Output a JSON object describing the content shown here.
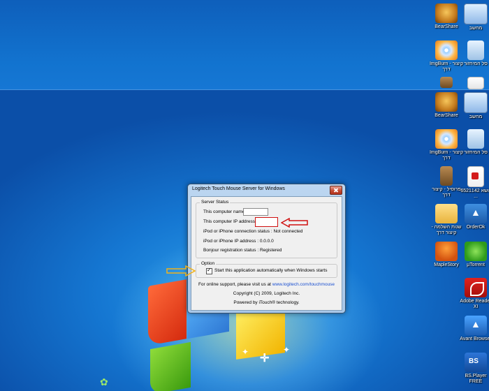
{
  "dialog": {
    "title": "Logitech Touch Mouse Server for Windows",
    "server_status": {
      "legend": "Server Status",
      "computer_name_label": "This computer name :",
      "computer_name_value": "",
      "ip_label": "This computer IP address :",
      "ip_value": "",
      "connection_label": "iPod or iPhone connection status :",
      "connection_value": "Not connected",
      "device_ip_label": "iPod or iPhone IP address :",
      "device_ip_value": "0.0.0.0",
      "bonjour_label": "Bonjour registration status :",
      "bonjour_value": "Registered"
    },
    "option": {
      "legend": "Option",
      "autostart_label": "Start this application automatically when Windows starts",
      "autostart_checked": true
    },
    "support_prefix": "For online support, please visit us at",
    "support_link": "www.logitech.com/touchmouse",
    "copyright": "Copyright (C) 2009, Logitech Inc.",
    "powered": "Powered by iTouch® technology."
  },
  "desktop_icons": [
    {
      "label": "BearShare",
      "icon": "bearshare-icon"
    },
    {
      "label": "מחשב",
      "icon": "computer-icon"
    },
    {
      "label": "ImgBurn - קיצור דרך",
      "icon": "imgburn-icon"
    },
    {
      "label": "סל המיחזור",
      "icon": "recycle-bin-icon"
    },
    {
      "label": "BearShare",
      "icon": "bearshare-icon"
    },
    {
      "label": "מחשב",
      "icon": "computer-icon"
    },
    {
      "label": "ImgBurn - קיצור דרך",
      "icon": "imgburn-icon"
    },
    {
      "label": "סל המיחזור",
      "icon": "recycle-bin-icon"
    },
    {
      "label": "פרוסיל - קיצור דרך",
      "icon": "shortcut-icon"
    },
    {
      "label": "נושא 6521142 ...",
      "icon": "pdf-icon"
    },
    {
      "label": "שנות השלמה - קיצור דרך",
      "icon": "folder-icon"
    },
    {
      "label": "OrderOk",
      "icon": "orderok-icon"
    },
    {
      "label": "MapleStory",
      "icon": "maplestory-icon"
    },
    {
      "label": "µTorrent",
      "icon": "utorrent-icon"
    },
    {
      "label": "Adobe Reader XI",
      "icon": "adobe-reader-icon"
    },
    {
      "label": "Avant Browser",
      "icon": "avant-browser-icon"
    },
    {
      "label": "BS.Player FREE",
      "icon": "bsplayer-icon"
    }
  ],
  "colors": {
    "annotation_red": "#d01010",
    "annotation_orange": "#f2b21a",
    "link": "#1a4fd0"
  }
}
